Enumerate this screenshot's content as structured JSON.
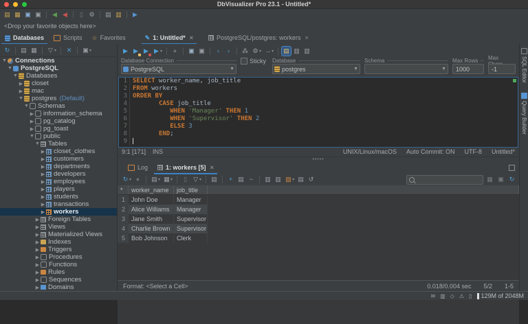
{
  "colors": {
    "accent": "#3a83c9",
    "selection": "#16334a",
    "keyword": "#cc7832",
    "string": "#6a8759",
    "number": "#6897bb",
    "editor_bg": "#2b2b2b",
    "panel_bg": "#3c3f41"
  },
  "window": {
    "title": "DbVisualizer Pro 23.1 - Untitled*"
  },
  "main_toolbar": {
    "icons": [
      {
        "name": "open-file-icon",
        "glyph": "▤",
        "color": "#c9a554"
      },
      {
        "name": "open-recent-icon",
        "glyph": "▦",
        "color": "#c9a554"
      },
      {
        "name": "save-icon",
        "glyph": "▣",
        "color": "#8ab0d8"
      },
      {
        "name": "save-as-icon",
        "glyph": "▣",
        "color": "#9aa0a6"
      },
      {
        "name": "sep"
      },
      {
        "name": "connect-icon",
        "glyph": "◀",
        "color": "#5c9e53"
      },
      {
        "name": "disconnect-icon",
        "glyph": "◀",
        "color": "#c75450"
      },
      {
        "name": "sep"
      },
      {
        "name": "commit-icon",
        "glyph": "▯",
        "color": "#76797c"
      },
      {
        "name": "tools-icon",
        "glyph": "⚙",
        "color": "#9aa0a6"
      },
      {
        "name": "sep"
      },
      {
        "name": "notebook-icon",
        "glyph": "▤",
        "color": "#9aa0a6"
      },
      {
        "name": "bookmark-editor-icon",
        "glyph": "▥",
        "color": "#c9a554"
      },
      {
        "name": "sep"
      },
      {
        "name": "new-object-icon",
        "glyph": "▶",
        "color": "#5894d1"
      }
    ]
  },
  "favorites_bar": {
    "text": "<Drop your favorite objects here>"
  },
  "left_tabs": [
    {
      "label": "Databases",
      "icon": "databases-icon",
      "active": true
    },
    {
      "label": "Scripts",
      "icon": "scripts-icon",
      "active": false
    },
    {
      "label": "Favorites",
      "icon": "star-icon",
      "active": false
    }
  ],
  "editor_tabs": [
    {
      "label": "1: Untitled*",
      "icon": "sql-pencil-icon",
      "active": true
    },
    {
      "label": "PostgreSQL/postgres: workers",
      "icon": "table-tab-icon",
      "active": false
    }
  ],
  "tree": {
    "toolbar": [
      {
        "name": "tree-refresh-icon",
        "glyph": "↻",
        "color": "#4c9fd8"
      },
      {
        "name": "sep"
      },
      {
        "name": "tree-connect-icon",
        "glyph": "▤",
        "color": "#9aa0a6"
      },
      {
        "name": "tree-folder-icon",
        "glyph": "▦",
        "color": "#9aa0a6"
      },
      {
        "name": "sep"
      },
      {
        "name": "tree-filter-icon",
        "glyph": "▽",
        "color": "#9aa0a6",
        "dd": true
      },
      {
        "name": "sep"
      },
      {
        "name": "tree-collapse-icon",
        "glyph": "✕",
        "color": "#4c9fd8"
      },
      {
        "name": "sep"
      },
      {
        "name": "tree-tab-icon",
        "glyph": "▣",
        "color": "#9aa0a6",
        "dd": true
      }
    ],
    "items": [
      {
        "label": "Connections",
        "level": 0,
        "state": "expanded",
        "icon": "sphere",
        "bold": true
      },
      {
        "label": "PostgreSQL",
        "level": 1,
        "state": "expanded",
        "icon": "conn",
        "bold": true
      },
      {
        "label": "Databases",
        "level": 2,
        "state": "expanded",
        "icon": "db"
      },
      {
        "label": "closet",
        "level": 3,
        "state": "collapsed",
        "icon": "db"
      },
      {
        "label": "mac",
        "level": 3,
        "state": "collapsed",
        "icon": "db"
      },
      {
        "label": "postgres",
        "level": 3,
        "state": "expanded",
        "icon": "db",
        "suffix": "(Default)"
      },
      {
        "label": "Schemas",
        "level": 4,
        "state": "expanded",
        "icon": "schema"
      },
      {
        "label": "information_schema",
        "level": 5,
        "state": "collapsed",
        "icon": "schema"
      },
      {
        "label": "pg_catalog",
        "level": 5,
        "state": "collapsed",
        "icon": "schema"
      },
      {
        "label": "pg_toast",
        "level": 5,
        "state": "collapsed",
        "icon": "schema"
      },
      {
        "label": "public",
        "level": 5,
        "state": "expanded",
        "icon": "schema"
      },
      {
        "label": "Tables",
        "level": 6,
        "state": "expanded",
        "icon": "grid-gray"
      },
      {
        "label": "closet_clothes",
        "level": 7,
        "state": "collapsed",
        "icon": "grid-blue"
      },
      {
        "label": "customers",
        "level": 7,
        "state": "collapsed",
        "icon": "grid-blue"
      },
      {
        "label": "departments",
        "level": 7,
        "state": "collapsed",
        "icon": "grid-blue"
      },
      {
        "label": "developers",
        "level": 7,
        "state": "collapsed",
        "icon": "grid-blue"
      },
      {
        "label": "employees",
        "level": 7,
        "state": "collapsed",
        "icon": "grid-blue"
      },
      {
        "label": "players",
        "level": 7,
        "state": "collapsed",
        "icon": "grid-blue"
      },
      {
        "label": "students",
        "level": 7,
        "state": "collapsed",
        "icon": "grid-blue"
      },
      {
        "label": "transactions",
        "level": 7,
        "state": "collapsed",
        "icon": "grid-blue"
      },
      {
        "label": "workers",
        "level": 7,
        "state": "collapsed",
        "icon": "grid-org",
        "selected": true
      },
      {
        "label": "Foreign Tables",
        "level": 6,
        "state": "collapsed",
        "icon": "grid-gray"
      },
      {
        "label": "Views",
        "level": 6,
        "state": "collapsed",
        "icon": "grid-gray"
      },
      {
        "label": "Materialized Views",
        "level": 6,
        "state": "collapsed",
        "icon": "grid-gray"
      },
      {
        "label": "Indexes",
        "level": 6,
        "state": "collapsed",
        "icon": "box-yel"
      },
      {
        "label": "Triggers",
        "level": 6,
        "state": "collapsed",
        "icon": "box-org"
      },
      {
        "label": "Procedures",
        "level": 6,
        "state": "collapsed",
        "icon": "schema"
      },
      {
        "label": "Functions",
        "level": 6,
        "state": "collapsed",
        "icon": "schema"
      },
      {
        "label": "Rules",
        "level": 6,
        "state": "collapsed",
        "icon": "box-org"
      },
      {
        "label": "Sequences",
        "level": 6,
        "state": "collapsed",
        "icon": "schema"
      },
      {
        "label": "Domains",
        "level": 6,
        "state": "collapsed",
        "icon": "box-blue"
      }
    ]
  },
  "sql_toolbar": [
    {
      "name": "execute-icon",
      "glyph": "▶",
      "color": "#4c9fd8"
    },
    {
      "name": "execute-current-icon",
      "glyph": "▶",
      "color": "#4c9fd8",
      "dot": "#e8bf6a"
    },
    {
      "name": "execute-explain-icon",
      "glyph": "▶",
      "color": "#4c9fd8",
      "dot": "#c75450"
    },
    {
      "name": "execute-options-icon",
      "glyph": "▶",
      "color": "#4c9fd8",
      "dd": true
    },
    {
      "name": "sep"
    },
    {
      "name": "stop-icon",
      "glyph": "●",
      "color": "#6e6e6e"
    },
    {
      "name": "sep"
    },
    {
      "name": "save-sql-icon",
      "glyph": "▣",
      "color": "#9fb6cc"
    },
    {
      "name": "save-sql-as-icon",
      "glyph": "▣",
      "color": "#9aa0a6"
    },
    {
      "name": "sep"
    },
    {
      "name": "history-back-icon",
      "glyph": "‹",
      "color": "#4c9fd8"
    },
    {
      "name": "history-forward-icon",
      "glyph": "›",
      "color": "#4c9fd8"
    },
    {
      "name": "sep"
    },
    {
      "name": "share-icon",
      "glyph": "⁂",
      "color": "#9aa0a6"
    },
    {
      "name": "format-sql-icon",
      "glyph": "⚙",
      "color": "#9aa0a6",
      "dd": true
    },
    {
      "name": "inject-icon",
      "glyph": "→",
      "color": "#9aa0a6",
      "dd": true
    },
    {
      "name": "sep"
    },
    {
      "name": "editor-log-toggle-icon",
      "glyph": "▤",
      "color": "#e8bf6a",
      "hl": true
    },
    {
      "name": "editor-split-icon",
      "glyph": "▥",
      "color": "#9aa0a6"
    },
    {
      "name": "editor-layout-icon",
      "glyph": "▥",
      "color": "#9aa0a6"
    }
  ],
  "connection_bar": {
    "connection_label": "Database Connection",
    "connection_value": "PostgreSQL",
    "sticky_label": "Sticky",
    "database_label": "Database",
    "database_value": "postgres",
    "schema_label": "Schema",
    "schema_value": "",
    "max_rows_label": "Max Rows",
    "max_rows_value": "1000",
    "max_chars_label": "Max Chars",
    "max_chars_value": "-1"
  },
  "editor": {
    "lines": [
      {
        "num": "1",
        "segments": [
          [
            "kw",
            "SELECT"
          ],
          [
            "pl",
            " worker_name, job_title"
          ]
        ]
      },
      {
        "num": "2",
        "segments": [
          [
            "kw",
            "FROM"
          ],
          [
            "pl",
            " workers"
          ]
        ]
      },
      {
        "num": "3",
        "segments": [
          [
            "kw",
            "ORDER BY"
          ]
        ]
      },
      {
        "num": "4",
        "segments": [
          [
            "pl",
            "       "
          ],
          [
            "kw",
            "CASE"
          ],
          [
            "pl",
            " job_title"
          ]
        ]
      },
      {
        "num": "5",
        "segments": [
          [
            "pl",
            "          "
          ],
          [
            "kw",
            "WHEN"
          ],
          [
            "pl",
            " "
          ],
          [
            "str",
            "'Manager'"
          ],
          [
            "pl",
            " "
          ],
          [
            "kw",
            "THEN"
          ],
          [
            "num",
            " 1"
          ]
        ]
      },
      {
        "num": "6",
        "segments": [
          [
            "pl",
            "          "
          ],
          [
            "kw",
            "WHEN"
          ],
          [
            "pl",
            " "
          ],
          [
            "str",
            "'Supervisor'"
          ],
          [
            "pl",
            " "
          ],
          [
            "kw",
            "THEN"
          ],
          [
            "num",
            " 2"
          ]
        ]
      },
      {
        "num": "7",
        "segments": [
          [
            "pl",
            "          "
          ],
          [
            "kw",
            "ELSE"
          ],
          [
            "num",
            " 3"
          ]
        ]
      },
      {
        "num": "8",
        "segments": [
          [
            "pl",
            "       "
          ],
          [
            "kw",
            "END"
          ],
          [
            "pl",
            ";"
          ]
        ]
      },
      {
        "num": "9",
        "segments": [],
        "caret": true
      }
    ],
    "status_left": [
      "9:1 [171]",
      "INS"
    ],
    "status_right": [
      "UNIX/Linux/macOS",
      "Auto Commit: ON",
      "UTF-8",
      "Untitled*"
    ]
  },
  "results": {
    "tabs": [
      {
        "label": "Log",
        "icon": "log-icon",
        "active": false
      },
      {
        "label": "1: workers [5]",
        "icon": "result-grid-icon",
        "active": true,
        "closable": true
      }
    ],
    "toolbar": [
      {
        "name": "result-refresh-icon",
        "glyph": "↻",
        "color": "#4c9fd8",
        "dd": true
      },
      {
        "name": "result-stop-icon",
        "glyph": "●",
        "color": "#6e6e6e"
      },
      {
        "name": "sep"
      },
      {
        "name": "export-icon",
        "glyph": "▤",
        "color": "#9aa0a6",
        "dd": true
      },
      {
        "name": "grid-view-icon",
        "glyph": "▦",
        "color": "#9aa0a6",
        "dd": true
      },
      {
        "name": "sep"
      },
      {
        "name": "delete-icon",
        "glyph": "▯",
        "color": "#76797c"
      },
      {
        "name": "filter-icon",
        "glyph": "▽",
        "color": "#9aa0a6",
        "dd": true
      },
      {
        "name": "sep"
      },
      {
        "name": "copy-cell-icon",
        "glyph": "▤",
        "color": "#9aa0a6"
      },
      {
        "name": "sep"
      },
      {
        "name": "insert-row-icon",
        "glyph": "+",
        "color": "#4c9fd8"
      },
      {
        "name": "duplicate-row-icon",
        "glyph": "▤",
        "color": "#9aa0a6"
      },
      {
        "name": "delete-row-icon",
        "glyph": "−",
        "color": "#9aa0a6"
      },
      {
        "name": "sep"
      },
      {
        "name": "form-view-icon",
        "glyph": "▥",
        "color": "#9aa0a6"
      },
      {
        "name": "transpose-icon",
        "glyph": "▥",
        "color": "#9aa0a6"
      },
      {
        "name": "import-icon",
        "glyph": "▨",
        "color": "#cb8742",
        "dd": true
      },
      {
        "name": "script-rows-icon",
        "glyph": "▤",
        "color": "#9aa0a6"
      },
      {
        "name": "undo-icon",
        "glyph": "↺",
        "color": "#9aa0a6"
      }
    ],
    "search_placeholder": "",
    "grid": {
      "corner": "*",
      "columns": [
        "worker_name",
        "job_title"
      ],
      "rows": [
        [
          "1",
          "John Doe",
          "Manager"
        ],
        [
          "2",
          "Alice Williams",
          "Manager"
        ],
        [
          "3",
          "Jane Smith",
          "Supervisor"
        ],
        [
          "4",
          "Charlie Brown",
          "Supervisor"
        ],
        [
          "5",
          "Bob Johnson",
          "Clerk"
        ]
      ]
    },
    "format_label": "Format: <Select a Cell>",
    "timing": "0.018/0.004 sec",
    "rows_info": "5/2",
    "range_info": "1-5"
  },
  "side_tabs": [
    {
      "label": "SQL Editor"
    },
    {
      "label": "Query Builder"
    }
  ],
  "app_status": {
    "memory": "129M of 2048M",
    "icons": [
      {
        "name": "mail-icon",
        "glyph": "✉",
        "color": "#9ea2a5"
      },
      {
        "name": "monitor-icon",
        "glyph": "▥",
        "color": "#9ea2a5"
      },
      {
        "name": "key-icon",
        "glyph": "◇",
        "color": "#9ea2a5"
      },
      {
        "name": "alerts-icon",
        "glyph": "⚠",
        "color": "#9ea2a5"
      },
      {
        "name": "trash-icon",
        "glyph": "▯",
        "color": "#9ea2a5"
      }
    ]
  }
}
